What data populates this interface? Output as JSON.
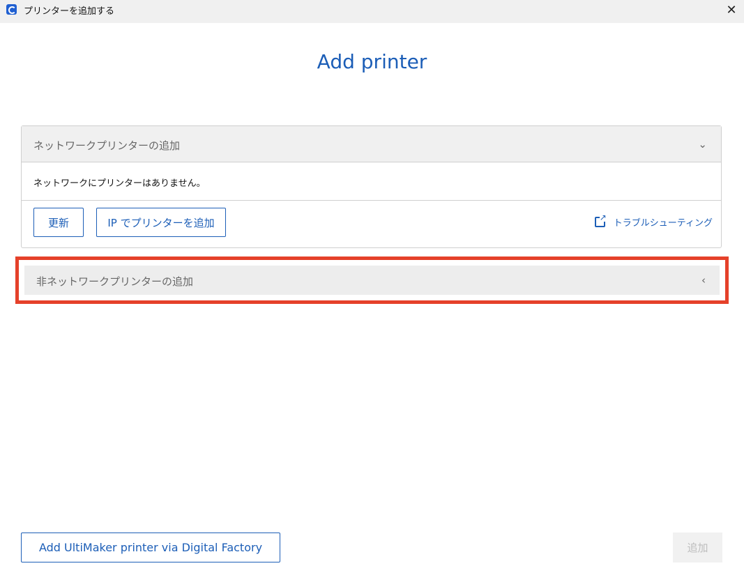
{
  "window": {
    "title": "プリンターを追加する",
    "close_glyph": "✕"
  },
  "page": {
    "title": "Add printer"
  },
  "network_section": {
    "header": "ネットワークプリンターの追加",
    "chevron": "⌄",
    "empty_message": "ネットワークにプリンターはありません。",
    "refresh_label": "更新",
    "add_by_ip_label": "IP でプリンターを追加",
    "troubleshoot_label": "トラブルシューティング"
  },
  "non_network_section": {
    "header": "非ネットワークプリンターの追加",
    "chevron": "‹"
  },
  "footer": {
    "digital_factory_label": "Add UltiMaker printer via Digital Factory",
    "add_label": "追加"
  },
  "colors": {
    "accent": "#1c5eb7",
    "highlight": "#e5412a"
  }
}
